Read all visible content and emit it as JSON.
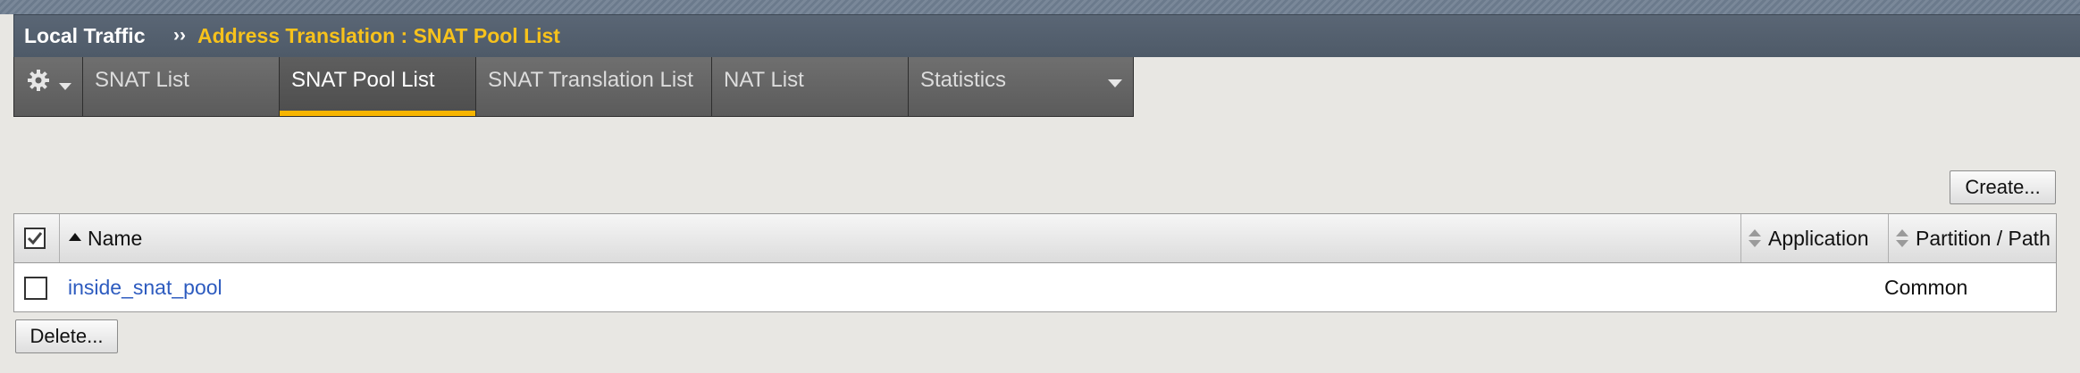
{
  "breadcrumb": {
    "section": "Local Traffic",
    "separator": "››",
    "page": "Address Translation : SNAT Pool List"
  },
  "tabs": [
    {
      "label": "SNAT List",
      "active": false
    },
    {
      "label": "SNAT Pool List",
      "active": true
    },
    {
      "label": "SNAT Translation List",
      "active": false
    },
    {
      "label": "NAT List",
      "active": false
    },
    {
      "label": "Statistics",
      "active": false
    }
  ],
  "icons": {
    "settings": "gear-icon",
    "menu_caret": "chevron-down-icon",
    "sort_ascending": "sort-ascending-icon",
    "sortable": "sort-icon"
  },
  "colors": {
    "breadcrumb_accent": "#f7c21c",
    "active_tab_underline": "#f7b500",
    "link": "#2d5bbf"
  },
  "toolbar": {
    "create_label": "Create...",
    "delete_label": "Delete..."
  },
  "table": {
    "select_all_checked": true,
    "columns": [
      "Name",
      "Application",
      "Partition / Path"
    ],
    "rows": [
      {
        "checked": false,
        "name": "inside_snat_pool",
        "application": "",
        "partition": "Common"
      }
    ]
  }
}
